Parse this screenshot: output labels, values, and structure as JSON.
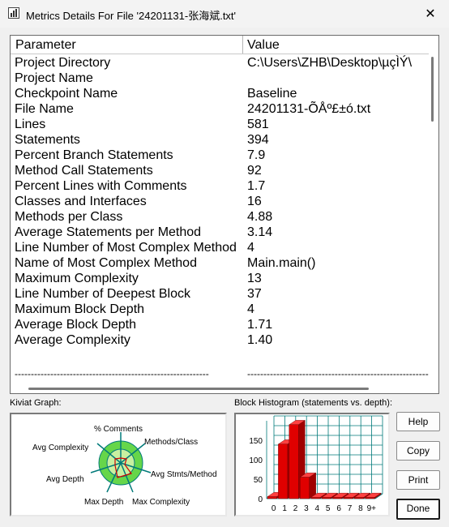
{
  "window": {
    "title": "Metrics Details For File '24201131-张海斌.txt'",
    "close_glyph": "✕"
  },
  "table": {
    "headers": {
      "parameter": "Parameter",
      "value": "Value"
    },
    "rows": [
      {
        "parameter": "Project Directory",
        "value": "C:\\Users\\ZHB\\Desktop\\µçÌÝ\\"
      },
      {
        "parameter": "Project Name",
        "value": ""
      },
      {
        "parameter": "Checkpoint Name",
        "value": "Baseline"
      },
      {
        "parameter": "File Name",
        "value": "24201131-ÕÅº£±ó.txt"
      },
      {
        "parameter": "Lines",
        "value": "581"
      },
      {
        "parameter": "Statements",
        "value": "394"
      },
      {
        "parameter": "Percent Branch Statements",
        "value": "7.9"
      },
      {
        "parameter": "Method Call Statements",
        "value": "92"
      },
      {
        "parameter": "Percent Lines with Comments",
        "value": "1.7"
      },
      {
        "parameter": "Classes and Interfaces",
        "value": "16"
      },
      {
        "parameter": "Methods per Class",
        "value": "4.88"
      },
      {
        "parameter": "Average Statements per Method",
        "value": "3.14"
      },
      {
        "parameter": "Line Number of Most Complex Method",
        "value": "4"
      },
      {
        "parameter": "Name of Most Complex Method",
        "value": "Main.main()"
      },
      {
        "parameter": "Maximum Complexity",
        "value": "13"
      },
      {
        "parameter": "Line Number of Deepest Block",
        "value": "37"
      },
      {
        "parameter": "Maximum Block Depth",
        "value": "4"
      },
      {
        "parameter": "Average Block Depth",
        "value": "1.71"
      },
      {
        "parameter": "Average Complexity",
        "value": "1.40"
      }
    ],
    "separator_param": "------------------------------------------------------------",
    "separator_value": "------------------------------------------------------------------------"
  },
  "kiviat": {
    "label": "Kiviat Graph:",
    "axes": {
      "comments": "% Comments",
      "methods_class": "Methods/Class",
      "avg_stmts": "Avg Stmts/Method",
      "max_complexity": "Max Complexity",
      "max_depth": "Max Depth",
      "avg_depth": "Avg Depth",
      "avg_complexity": "Avg Complexity"
    }
  },
  "histogram": {
    "label": "Block Histogram (statements vs. depth):",
    "y_ticks": [
      "0",
      "50",
      "100",
      "150"
    ],
    "x_ticks": [
      "0",
      "1",
      "2",
      "3",
      "4",
      "5",
      "6",
      "7",
      "8",
      "9+"
    ],
    "values": [
      5,
      140,
      190,
      55,
      0,
      0,
      0,
      0,
      0,
      0
    ],
    "y_max": 200,
    "bar_color": "#e00000"
  },
  "buttons": {
    "help": "Help",
    "copy": "Copy",
    "print": "Print",
    "done": "Done"
  },
  "colors": {
    "kiviat_fill": "#66d64a",
    "kiviat_inner": "#c8f0a0",
    "kiviat_spokes": "#007a7a",
    "kiviat_data": "#d00000",
    "histogram_grid": "#007a7a"
  }
}
